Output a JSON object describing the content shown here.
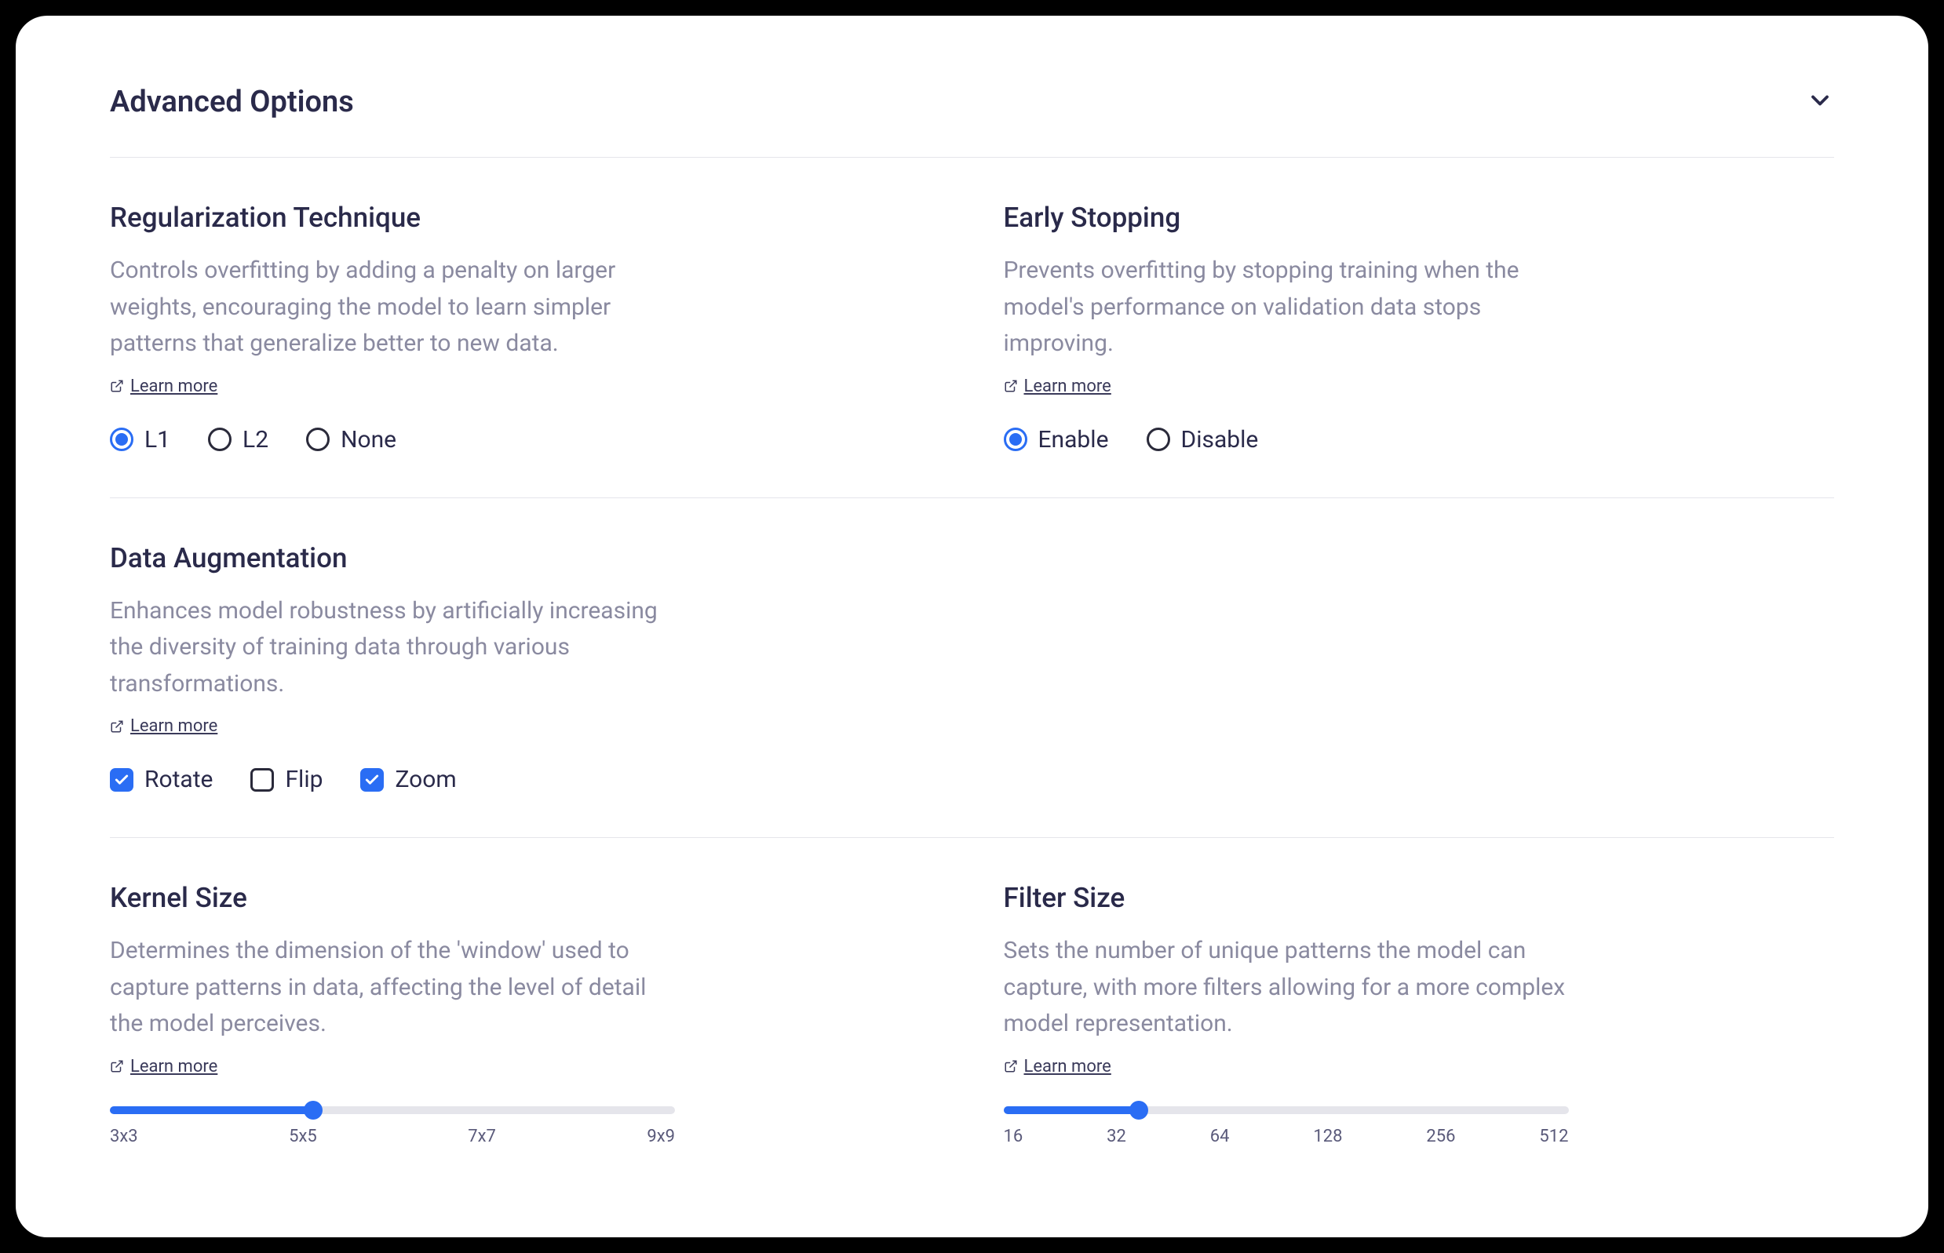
{
  "header": {
    "title": "Advanced Options"
  },
  "regularization": {
    "title": "Regularization Technique",
    "desc": "Controls overfitting by adding a penalty on larger weights, encouraging the model to learn simpler patterns that generalize better to new data.",
    "learn_more": "Learn more",
    "options": {
      "l1": "L1",
      "l2": "L2",
      "none": "None"
    },
    "selected": "l1"
  },
  "early_stopping": {
    "title": "Early Stopping",
    "desc": "Prevents overfitting by stopping training when the model's performance on validation data stops improving.",
    "learn_more": "Learn more",
    "options": {
      "enable": "Enable",
      "disable": "Disable"
    },
    "selected": "enable"
  },
  "augmentation": {
    "title": "Data Augmentation",
    "desc": "Enhances model robustness by artificially increasing the diversity of training data through various transformations.",
    "learn_more": "Learn more",
    "options": {
      "rotate": "Rotate",
      "flip": "Flip",
      "zoom": "Zoom"
    },
    "checked": {
      "rotate": true,
      "flip": false,
      "zoom": true
    }
  },
  "kernel": {
    "title": "Kernel Size",
    "desc": "Determines the dimension of the 'window' used to capture patterns in data, affecting the level of detail the model perceives.",
    "learn_more": "Learn more",
    "ticks": [
      "3x3",
      "5x5",
      "7x7",
      "9x9"
    ],
    "value_index": 1,
    "fill_percent": 33.3
  },
  "filter": {
    "title": "Filter Size",
    "desc": "Sets the number of unique patterns the model can capture, with more filters allowing for a more complex model representation.",
    "learn_more": "Learn more",
    "ticks": [
      "16",
      "32",
      "64",
      "128",
      "256",
      "512"
    ],
    "value_index": 1,
    "fill_percent": 20
  },
  "colors": {
    "accent": "#2a6df4",
    "text_primary": "#2a2a4a",
    "text_secondary": "#8a8aa0"
  }
}
